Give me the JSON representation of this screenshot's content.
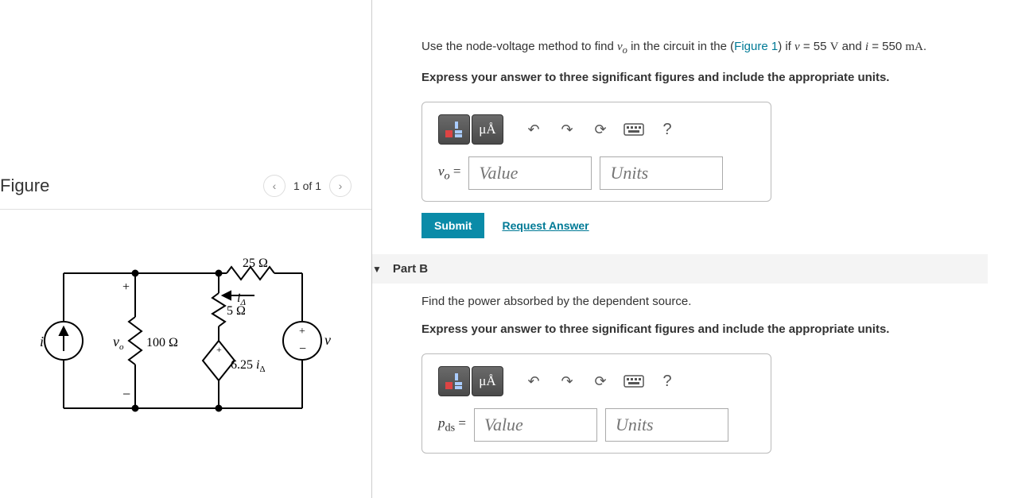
{
  "figure": {
    "title": "Figure",
    "counter": "1 of 1",
    "circuit": {
      "r_top": "25 Ω",
      "r_mid": "5 Ω",
      "r_left": "100 Ω",
      "i_delta": "iΔ",
      "dep_src": "6.25 iΔ",
      "vo": "vo",
      "v": "v",
      "i": "i",
      "plus": "+",
      "minus": "−"
    }
  },
  "partA": {
    "promptPrefix": "Use the node-voltage method to find ",
    "promptVar": "vo",
    "promptMid": " in the circuit in the (",
    "figLink": "Figure 1",
    "promptAfterLink": ") if ",
    "eq1_lhs": "v",
    "eq1_eq": " = 55 ",
    "eq1_unit": "V",
    "and": " and ",
    "eq2_lhs": "i",
    "eq2_eq": " = 550 ",
    "eq2_unit": "mA",
    "period": ".",
    "instruction": "Express your answer to three significant figures and include the appropriate units.",
    "varLabel": "vo =",
    "valuePlaceholder": "Value",
    "unitsPlaceholder": "Units",
    "submit": "Submit",
    "request": "Request Answer",
    "unitsBtn": "μÅ",
    "help": "?"
  },
  "partB": {
    "header": "Part B",
    "prompt": "Find the power absorbed by the dependent source.",
    "instruction": "Express your answer to three significant figures and include the appropriate units.",
    "varLabel": "pds =",
    "valuePlaceholder": "Value",
    "unitsPlaceholder": "Units",
    "unitsBtn": "μÅ",
    "help": "?"
  }
}
